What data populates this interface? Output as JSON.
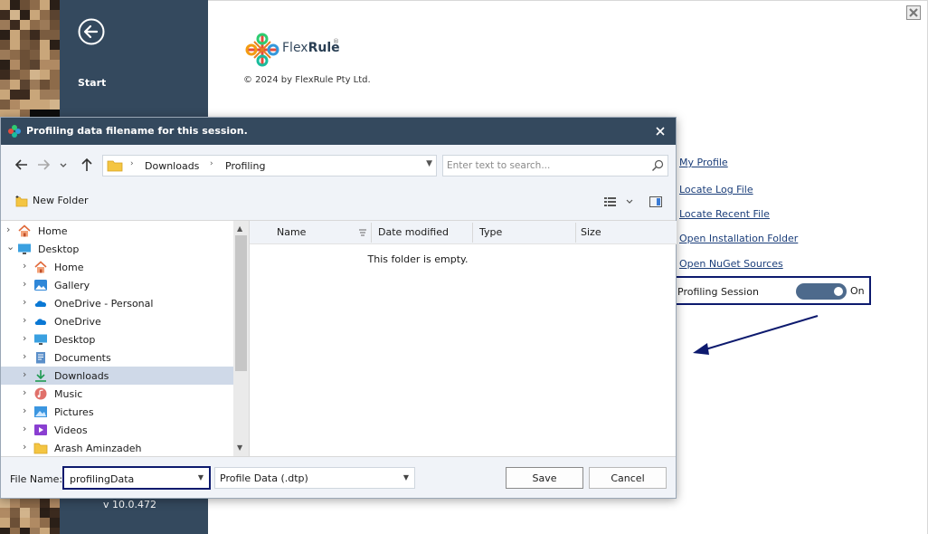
{
  "app": {
    "sidebar": {
      "start_label": "Start",
      "version": "v 10.0.472",
      "back_icon": "arrow-left-circle-icon"
    },
    "logo_text_a": "Flex",
    "logo_text_b": "Rule",
    "logo_reg": "®",
    "copyright": "© 2024 by FlexRule Pty Ltd.",
    "links": [
      "My Profile",
      "Locate Log File",
      "Locate Recent File",
      "Open Installation Folder",
      "Open NuGet Sources"
    ],
    "profiling": {
      "label": "Profiling Session",
      "state": "On"
    },
    "colors": {
      "sidebar": "#34495e",
      "link": "#1b3e7a",
      "highlight": "#0d1a6e",
      "toggle": "#4d6a8c"
    }
  },
  "dialog": {
    "title": "Profiling data filename for this session.",
    "breadcrumb": [
      "Downloads",
      "Profiling"
    ],
    "search_placeholder": "Enter text to search...",
    "new_folder_label": "New Folder",
    "tree": [
      {
        "label": "Home",
        "icon": "home-icon",
        "level": 0,
        "expanded": false
      },
      {
        "label": "Desktop",
        "icon": "desktop-icon",
        "level": 0,
        "expanded": true
      },
      {
        "label": "Home",
        "icon": "home-icon",
        "level": 1,
        "expanded": false
      },
      {
        "label": "Gallery",
        "icon": "gallery-icon",
        "level": 1,
        "expanded": false
      },
      {
        "label": "OneDrive - Personal",
        "icon": "cloud-icon",
        "level": 1,
        "expanded": false
      },
      {
        "label": "OneDrive",
        "icon": "cloud-icon",
        "level": 1,
        "expanded": false
      },
      {
        "label": "Desktop",
        "icon": "desktop-icon",
        "level": 1,
        "expanded": false
      },
      {
        "label": "Documents",
        "icon": "document-icon",
        "level": 1,
        "expanded": false
      },
      {
        "label": "Downloads",
        "icon": "download-icon",
        "level": 1,
        "expanded": false,
        "selected": true
      },
      {
        "label": "Music",
        "icon": "music-icon",
        "level": 1,
        "expanded": false
      },
      {
        "label": "Pictures",
        "icon": "pictures-icon",
        "level": 1,
        "expanded": false
      },
      {
        "label": "Videos",
        "icon": "videos-icon",
        "level": 1,
        "expanded": false
      },
      {
        "label": "Arash Aminzadeh",
        "icon": "folder-icon",
        "level": 1,
        "expanded": false
      }
    ],
    "columns": [
      "Name",
      "Date modified",
      "Type",
      "Size"
    ],
    "empty_message": "This folder is empty.",
    "file_name_label": "File Name:",
    "file_name_value": "profilingData",
    "file_type": "Profile Data (.dtp)",
    "save_label": "Save",
    "cancel_label": "Cancel"
  }
}
